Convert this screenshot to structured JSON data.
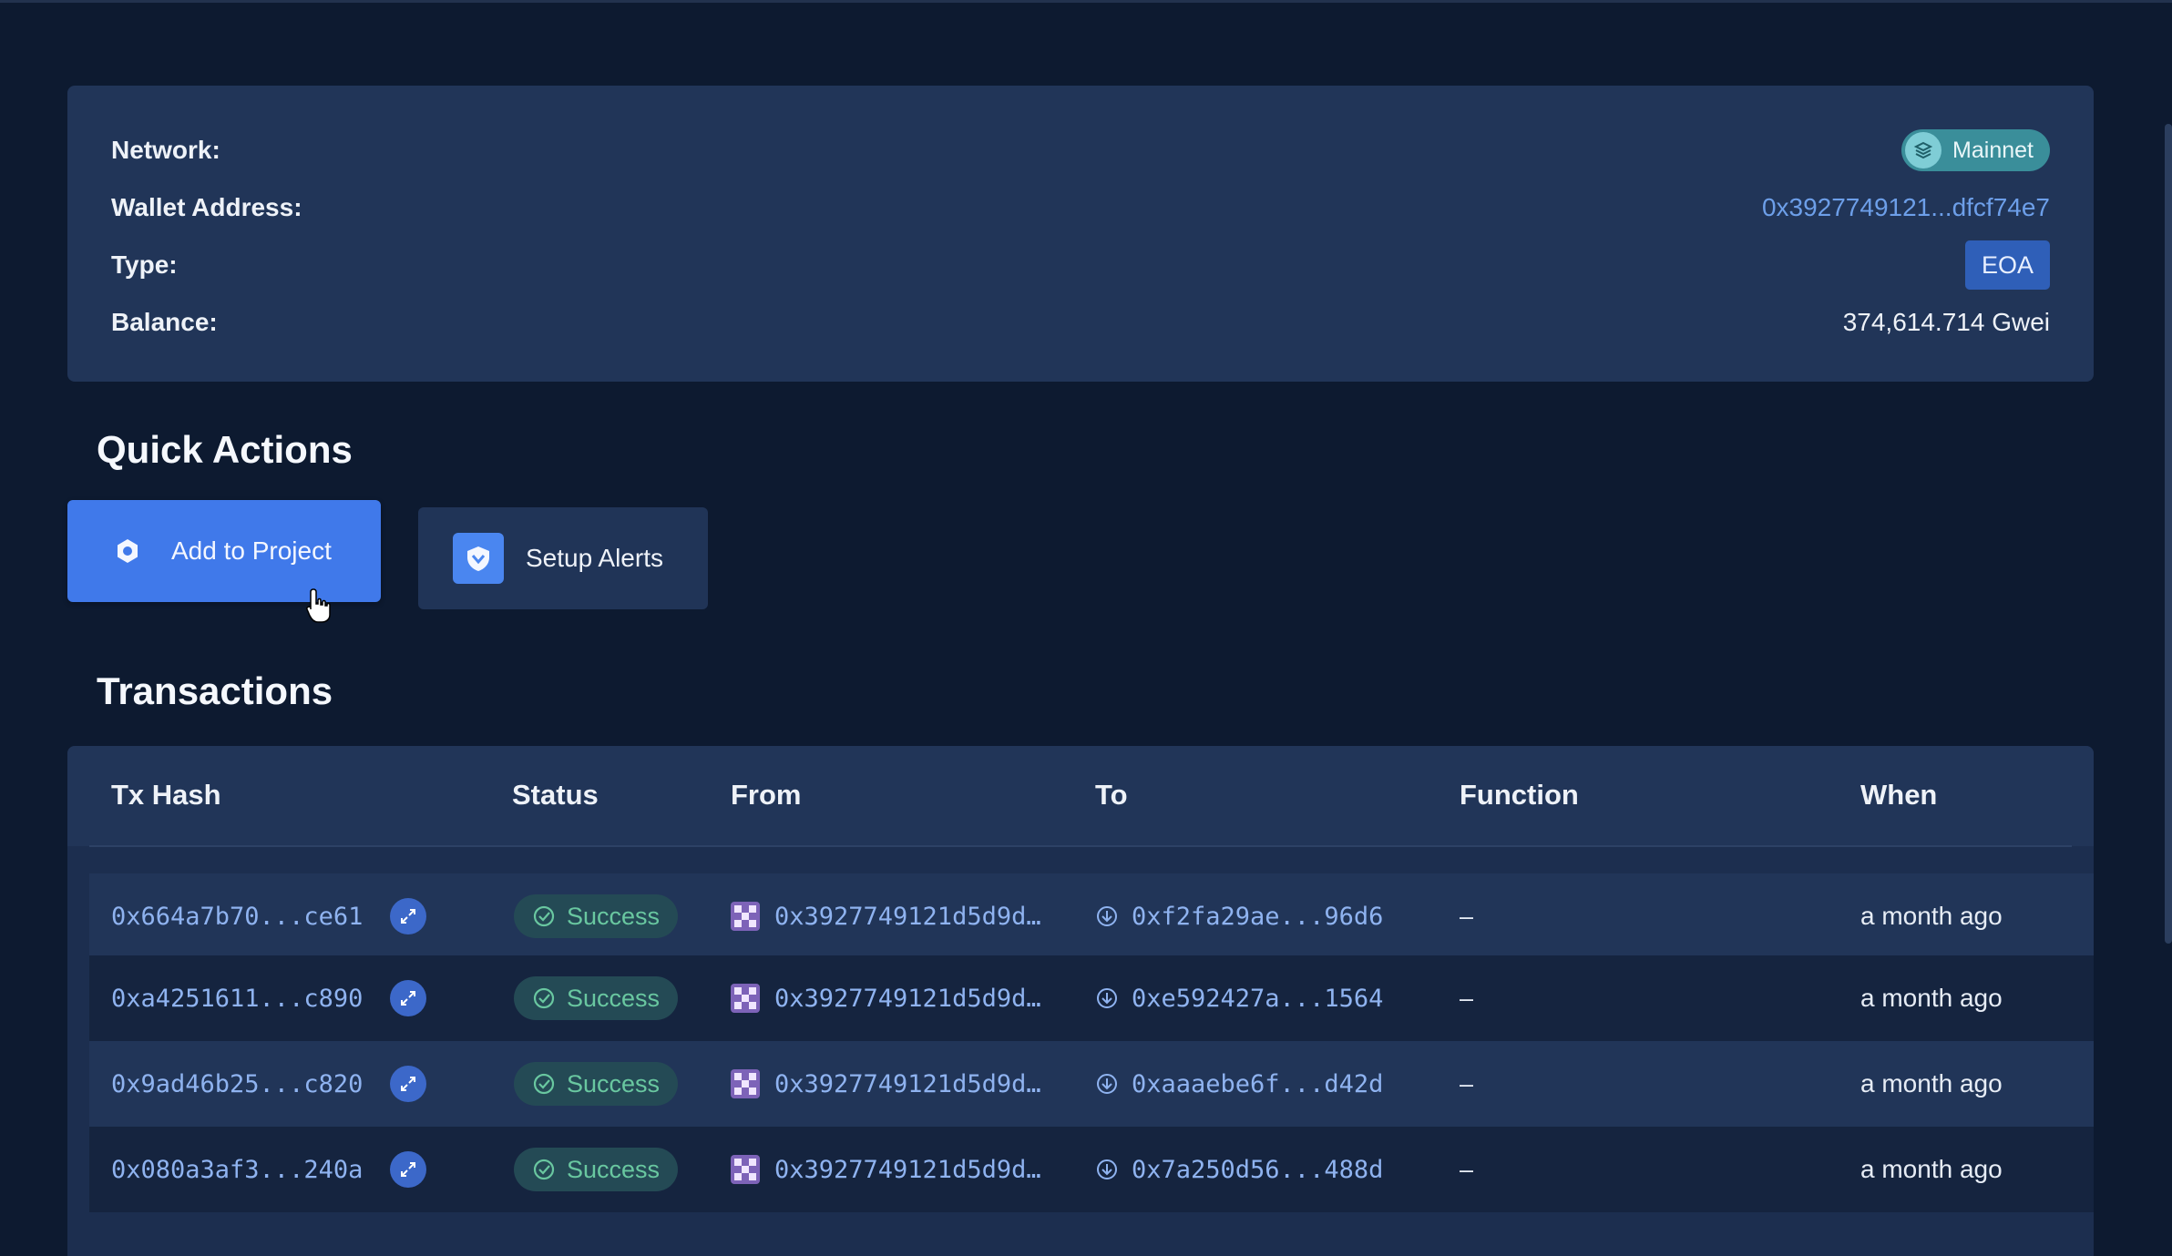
{
  "wallet_info": {
    "network_label": "Network:",
    "network_value": "Mainnet",
    "wallet_label": "Wallet Address:",
    "wallet_value": "0x3927749121...dfcf74e7",
    "type_label": "Type:",
    "type_value": "EOA",
    "balance_label": "Balance:",
    "balance_value": "374,614.714 Gwei"
  },
  "quick_actions": {
    "title": "Quick Actions",
    "add_to_project": "Add to Project",
    "setup_alerts": "Setup Alerts"
  },
  "transactions": {
    "title": "Transactions",
    "columns": [
      "Tx Hash",
      "Status",
      "From",
      "To",
      "Function",
      "When"
    ],
    "rows": [
      {
        "hash": "0x664a7b70...ce61",
        "status": "Success",
        "from": "0x3927749121d5d9d…",
        "to": "0xf2fa29ae...96d6",
        "function": "–",
        "when": "a month ago"
      },
      {
        "hash": "0xa4251611...c890",
        "status": "Success",
        "from": "0x3927749121d5d9d…",
        "to": "0xe592427a...1564",
        "function": "–",
        "when": "a month ago"
      },
      {
        "hash": "0x9ad46b25...c820",
        "status": "Success",
        "from": "0x3927749121d5d9d…",
        "to": "0xaaaebe6f...d42d",
        "function": "–",
        "when": "a month ago"
      },
      {
        "hash": "0x080a3af3...240a",
        "status": "Success",
        "from": "0x3927749121d5d9d…",
        "to": "0x7a250d56...488d",
        "function": "–",
        "when": "a month ago"
      }
    ]
  },
  "colors": {
    "background": "#0d1a30",
    "card": "#213558",
    "accent": "#4079ea",
    "success": "#69c7a0"
  }
}
